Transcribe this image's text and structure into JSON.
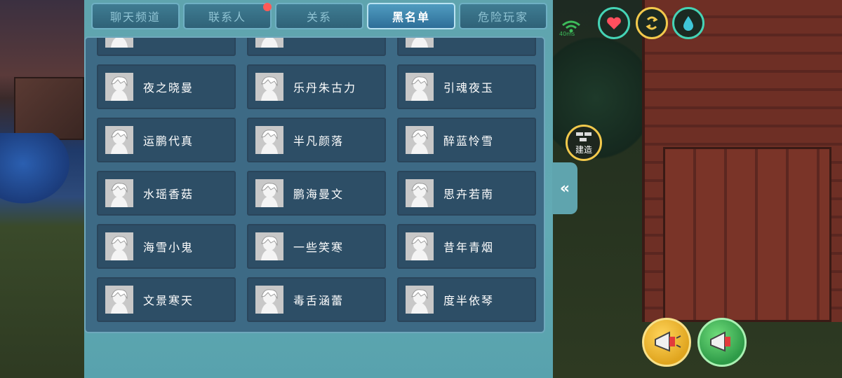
{
  "tabs": [
    {
      "label": "聊天频道",
      "active": false,
      "badge": false
    },
    {
      "label": "联系人",
      "active": false,
      "badge": true
    },
    {
      "label": "关系",
      "active": false,
      "badge": false
    },
    {
      "label": "黑名单",
      "active": true,
      "badge": false
    },
    {
      "label": "危险玩家",
      "active": false,
      "badge": false
    }
  ],
  "blacklist": [
    {
      "name": ""
    },
    {
      "name": ""
    },
    {
      "name": ""
    },
    {
      "name": "夜之晓曼"
    },
    {
      "name": "乐丹朱古力"
    },
    {
      "name": "引魂夜玉"
    },
    {
      "name": "运鹏代真"
    },
    {
      "name": "半凡颜落"
    },
    {
      "name": "醉蓝怜雪"
    },
    {
      "name": "水瑶香菇"
    },
    {
      "name": "鹏海曼文"
    },
    {
      "name": "思卉若南"
    },
    {
      "name": "海雪小鬼"
    },
    {
      "name": "一些笑寒"
    },
    {
      "name": "昔年青烟"
    },
    {
      "name": "文景寒天"
    },
    {
      "name": "毒舌涵蕾"
    },
    {
      "name": "度半依琴"
    }
  ],
  "hud": {
    "collapse_glyph": "«",
    "build_label": "建造",
    "signal_label": "40ms",
    "colors": {
      "heart": "#ff4f5e",
      "energy": "#f2c94c",
      "water": "#3fc6d8",
      "ring": "#45d3b5"
    }
  }
}
